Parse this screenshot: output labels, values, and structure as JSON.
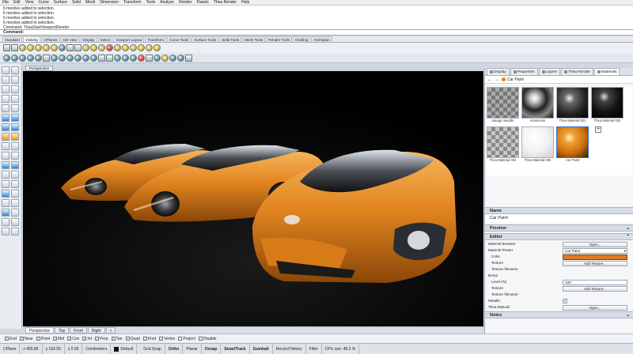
{
  "menu": [
    "File",
    "Edit",
    "View",
    "Curve",
    "Surface",
    "Solid",
    "Mesh",
    "Dimension",
    "Transform",
    "Tools",
    "Analyze",
    "Render",
    "Panels",
    "Thea Render",
    "Help"
  ],
  "history": [
    "6 meshes added to selection.",
    "6 meshes added to selection.",
    "6 meshes added to selection.",
    "6 meshes added to selection.",
    "Command: TheaStartViewportRender"
  ],
  "command_label": "Command:",
  "toolbar_tabs": [
    "Standard",
    "Visibility",
    "CPlanes",
    "Set View",
    "Display",
    "Select",
    "Viewport Layout",
    "Transform",
    "Curve Tools",
    "Surface Tools",
    "Solid Tools",
    "Mesh Tools",
    "Render Tools",
    "Drafting",
    "Animation"
  ],
  "active_toolbar_tab": "Visibility",
  "viewport": {
    "title": "Perspective"
  },
  "viewport_tabs": [
    "Perspective",
    "Top",
    "Front",
    "Right"
  ],
  "viewport_tab_add": "+",
  "osnaps": [
    {
      "label": "End",
      "checked": true
    },
    {
      "label": "Near",
      "checked": true
    },
    {
      "label": "Point",
      "checked": true
    },
    {
      "label": "Mid",
      "checked": true
    },
    {
      "label": "Cen",
      "checked": true
    },
    {
      "label": "Int",
      "checked": true
    },
    {
      "label": "Perp",
      "checked": true
    },
    {
      "label": "Tan",
      "checked": true
    },
    {
      "label": "Quad",
      "checked": true
    },
    {
      "label": "Knot",
      "checked": true
    },
    {
      "label": "Vertex",
      "checked": true
    },
    {
      "label": "Project",
      "checked": false
    },
    {
      "label": "Disable",
      "checked": false
    }
  ],
  "status": {
    "cplane": "CPlane",
    "x": "x 455.85",
    "y": "y 193.93",
    "z": "z 0.00",
    "units": "Centimeters",
    "layer": "Default",
    "grid_snap": "Grid Snap",
    "ortho": "Ortho",
    "planar": "Planar",
    "osnap": "Osnap",
    "smarttrack": "SmartTrack",
    "gumball": "Gumball",
    "record_history": "Record History",
    "filter": "Filter",
    "cpu": "CPU use: 48.3 %"
  },
  "panel_tabs": [
    "Display",
    "Properties",
    "Layers",
    "Thea Render",
    "Materials"
  ],
  "active_panel_tab": "Materials",
  "breadcrumb": "Car Paint",
  "materials": [
    {
      "name": "orange metallic",
      "style": "checker-metal"
    },
    {
      "name": "Aluminium",
      "style": "chrome"
    },
    {
      "name": "Thea Material 001",
      "style": "dark-glossy"
    },
    {
      "name": "Thea Material 002",
      "style": "black-glossy"
    },
    {
      "name": "Thea Material 004",
      "style": "checker"
    },
    {
      "name": "Thea Material 005",
      "style": "white"
    },
    {
      "name": "Car Paint",
      "style": "orange"
    }
  ],
  "selected_material": "Car Paint",
  "add_material": "+",
  "sections": {
    "name_header": "Name",
    "name_value": "Car Paint",
    "preview_header": "Preview",
    "editor_header": "Editor",
    "notes_header": "Notes"
  },
  "editor": {
    "material_browser_label": "Material Browser",
    "open_label": "Open...",
    "material_preset_label": "Material Preset",
    "material_preset_value": "Car Paint",
    "color_label": "Color",
    "color_value": "#e07a1d",
    "texture_label": "Texture",
    "add_texture_label": "Add Texture...",
    "texture_filename_label": "Texture filename",
    "bump_label": "Bump",
    "level_label": "Level (%)",
    "level_value": "100",
    "bump_texture_label": "Texture",
    "bump_add_texture_label": "Add Texture...",
    "bump_texture_filename_label": "Texture filename",
    "metallic_label": "Metallic",
    "metallic_checked": "✓",
    "thea_matlab_label": "Thea MatLab",
    "matlab_open_label": "Open..."
  },
  "colors": {
    "car_orange": "#e0841f",
    "accent_blue": "#2f6fd6",
    "viewport_bg": "#000000"
  }
}
